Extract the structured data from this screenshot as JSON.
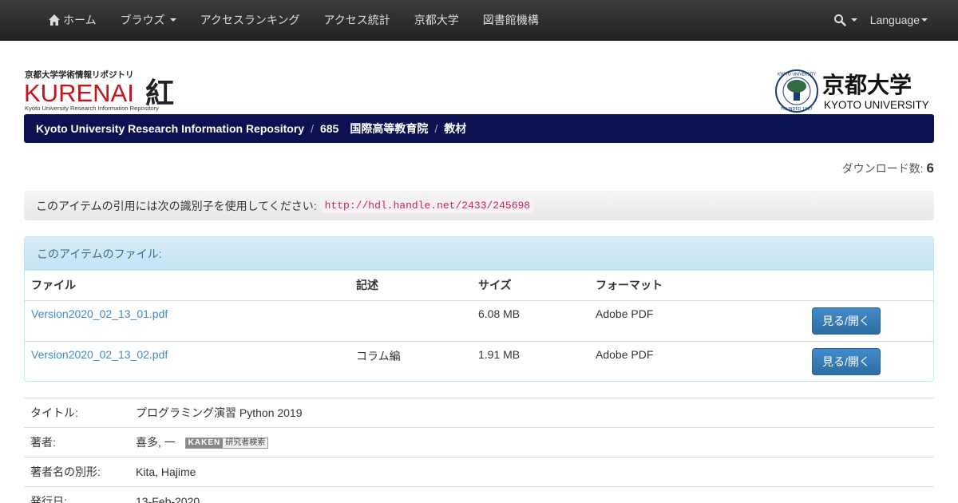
{
  "nav": {
    "home": "ホーム",
    "browse": "ブラウズ",
    "ranking": "アクセスランキング",
    "stats": "アクセス統計",
    "univ": "京都大学",
    "library": "図書館機構",
    "language": "Language"
  },
  "logo_left": {
    "top_text": "京都大学学術情報リポジトリ",
    "main_text": "KURENAI",
    "kanji": "紅",
    "sub_text": "Kyoto University Research Information Repository"
  },
  "logo_right": {
    "kanji": "京都大学",
    "english": "KYOTO UNIVERSITY",
    "seal_top": "KYOTO UNIVERSITY",
    "seal_bottom": "FOUNDED 1897"
  },
  "breadcrumb": {
    "items": [
      "Kyoto University Research Information Repository",
      "685　国際高等教育院",
      "教材"
    ]
  },
  "download": {
    "label": "ダウンロード数:",
    "value": "6"
  },
  "handle": {
    "label": "このアイテムの引用には次の識別子を使用してください:",
    "url": "http://hdl.handle.net/2433/245698"
  },
  "files": {
    "heading": "このアイテムのファイル:",
    "columns": [
      "ファイル",
      "記述",
      "サイズ",
      "フォーマット"
    ],
    "rows": [
      {
        "name": "Version2020_02_13_01.pdf",
        "desc": "",
        "size": "6.08 MB",
        "format": "Adobe PDF",
        "button": "見る/開く"
      },
      {
        "name": "Version2020_02_13_02.pdf",
        "desc": "コラム編",
        "size": "1.91 MB",
        "format": "Adobe PDF",
        "button": "見る/開く"
      }
    ]
  },
  "metadata": {
    "title_label": "タイトル:",
    "title_value": "プログラミング演習 Python 2019",
    "author_label": "著者:",
    "author_value": "喜多, 一",
    "kaken_a": "KAKEN",
    "kaken_b": "研究者検索",
    "alt_label": "著者名の別形:",
    "alt_value": "Kita, Hajime",
    "date_label": "発行日:",
    "date_value": "13-Feb-2020"
  },
  "colors": {
    "navbar": "#222222",
    "breadcrumb": "#0c1251",
    "kurenai_red": "#c4141c",
    "link": "#428bca",
    "button": "#337ab7"
  }
}
